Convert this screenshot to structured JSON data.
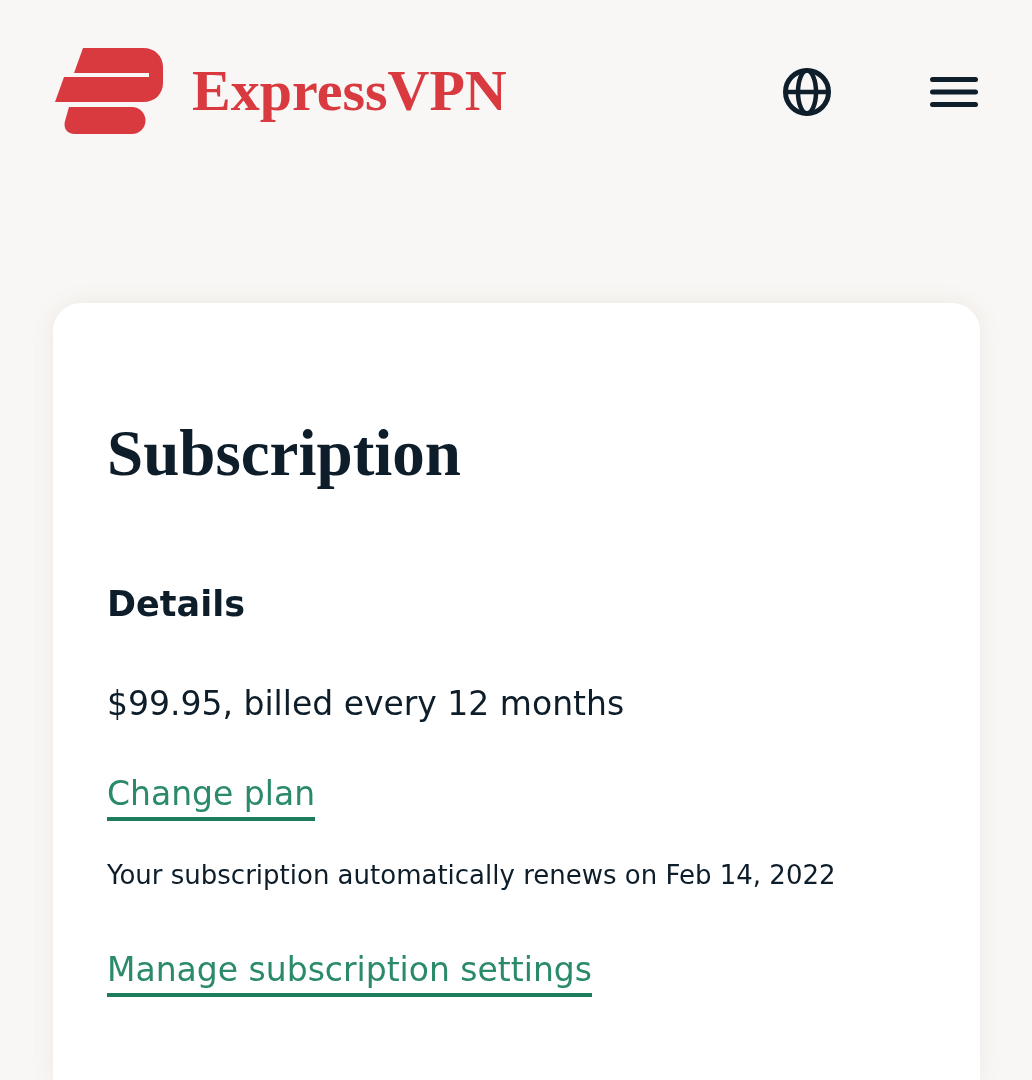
{
  "header": {
    "brand": "ExpressVPN"
  },
  "subscription_card": {
    "title": "Subscription",
    "section_title": "Details",
    "items": [
      {
        "kind": "body",
        "text": "$99.95, billed every 12 months"
      },
      {
        "kind": "link",
        "text": "Change plan"
      },
      {
        "kind": "note",
        "text": "Your subscription automatically renews on Feb 14, 2022"
      },
      {
        "kind": "link",
        "text": "Manage subscription settings"
      }
    ]
  }
}
